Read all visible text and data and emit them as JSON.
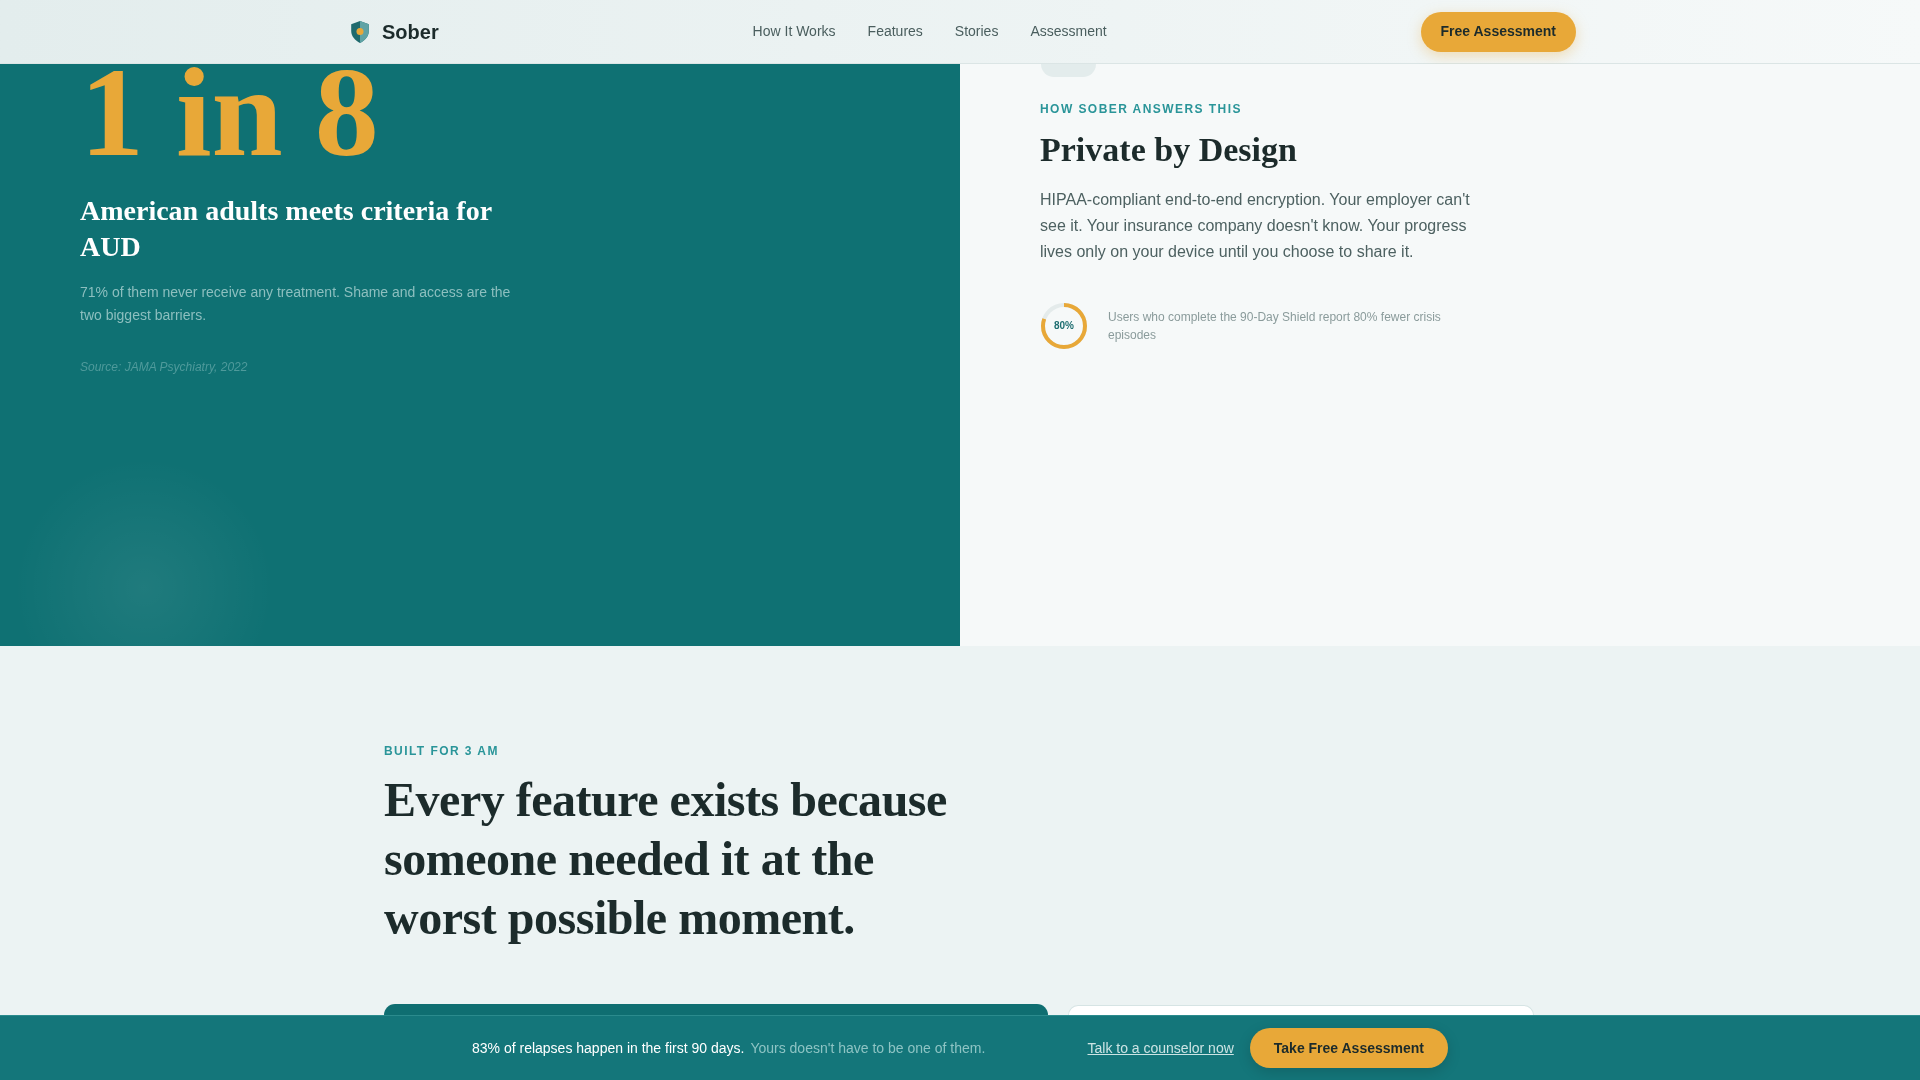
{
  "header": {
    "brand": "Sober",
    "nav": [
      "How It Works",
      "Features",
      "Stories",
      "Assessment"
    ],
    "cta": "Free Assessment"
  },
  "stat_panel": {
    "figure": "1 in 8",
    "headline": "American adults meets criteria for AUD",
    "body": "71% of them never receive any treatment. Shame and access are the two biggest barriers.",
    "source": "Source: JAMA Psychiatry, 2022"
  },
  "answer_panel": {
    "eyebrow": "HOW SOBER ANSWERS THIS",
    "title": "Private by Design",
    "body": "HIPAA-compliant end-to-end encryption. Your employer can't see it. Your insurance company doesn't know. Your progress lives only on your device until you choose to share it.",
    "metric": {
      "label": "80%",
      "level": 0.8,
      "caption": "Users who complete the 90-Day Shield report 80% fewer crisis episodes"
    }
  },
  "features": {
    "eyebrow": "BUILT FOR 3 AM",
    "title": "Every feature exists because someone needed it at the worst possible moment.",
    "cards": [
      {
        "kind": "dark"
      },
      {
        "kind": "light"
      }
    ]
  },
  "sticky_bar": {
    "message": "83% of relapses happen in the first 90 days.",
    "submessage": "Yours doesn't have to be one of them.",
    "link": "Talk to a counselor now",
    "button": "Take Free Assessment"
  }
}
